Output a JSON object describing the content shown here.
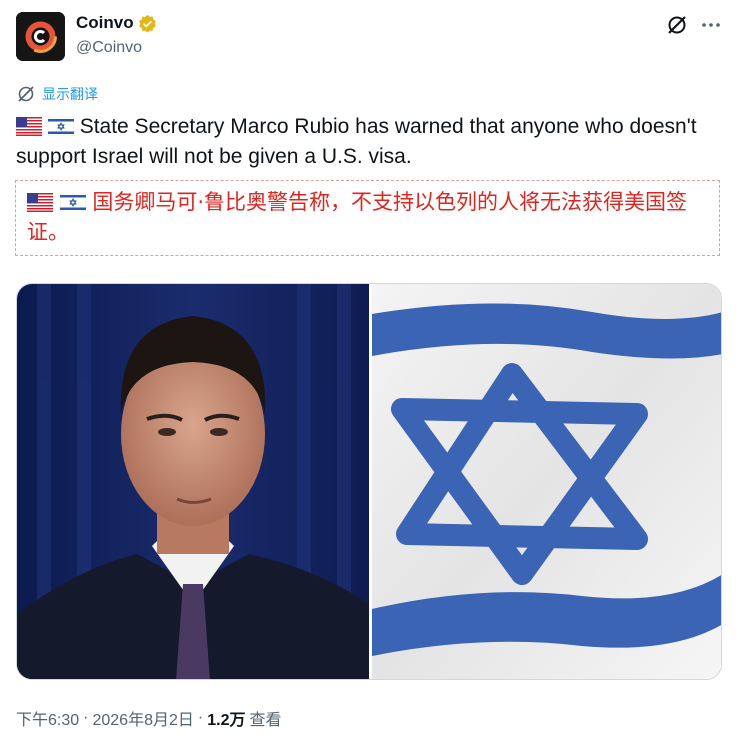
{
  "author": {
    "name": "Coinvo",
    "handle": "@Coinvo",
    "avatar_letter": "C"
  },
  "translate_link": "显示翻译",
  "tweet": {
    "text": "State Secretary Marco Rubio has warned that anyone who doesn't support Israel will not be given a U.S. visa.",
    "translated_text": "国务卿马可·鲁比奥警告称，不支持以色列的人将无法获得美国签证。"
  },
  "media": {
    "left_image": "portrait-photo",
    "right_image": "israel-flag-photo"
  },
  "meta": {
    "time": "下午6:30",
    "date": "2026年8月2日",
    "separator": "·",
    "views_count": "1.2万",
    "views_label": "查看"
  },
  "colors": {
    "link": "#1d9bf0",
    "translated": "#e0241e",
    "verified": "#e2b719",
    "flag_blue": "#2f57a8"
  }
}
